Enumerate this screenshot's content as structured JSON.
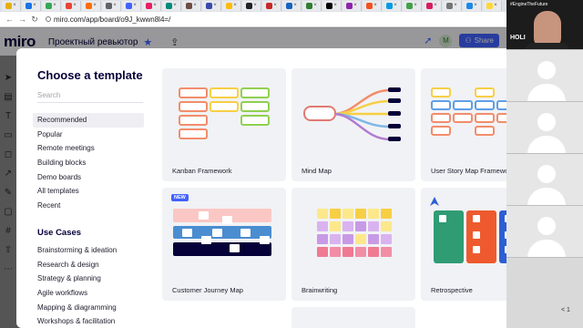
{
  "browser": {
    "url": "miro.com/app/board/o9J_kwwn8l4=/"
  },
  "app": {
    "logo": "miro",
    "board_name": "Проектный ревьютор",
    "share_label": "Share",
    "user_initial": "M"
  },
  "modal": {
    "title": "Choose a template",
    "search_placeholder": "Search",
    "categories": [
      {
        "label": "Recommended",
        "selected": true
      },
      {
        "label": "Popular"
      },
      {
        "label": "Remote meetings"
      },
      {
        "label": "Building blocks"
      },
      {
        "label": "Demo boards"
      },
      {
        "label": "All templates"
      },
      {
        "label": "Recent"
      }
    ],
    "use_cases_title": "Use Cases",
    "use_cases": [
      {
        "label": "Brainstorming & ideation"
      },
      {
        "label": "Research & design"
      },
      {
        "label": "Strategy & planning"
      },
      {
        "label": "Agile workflows"
      },
      {
        "label": "Mapping & diagramming"
      },
      {
        "label": "Workshops & facilitation"
      }
    ],
    "templates": [
      {
        "name": "Kanban Framework"
      },
      {
        "name": "Mind Map"
      },
      {
        "name": "User Story Map Framework"
      },
      {
        "name": "Customer Journey Map",
        "badge": "NEW"
      },
      {
        "name": "Brainwriting"
      },
      {
        "name": "Retrospective"
      }
    ]
  },
  "webcam": {
    "label": "#EngineTheFuture",
    "logo": "HOLI"
  },
  "edge_text": "< 1",
  "colors": {
    "accent": "#4262ff",
    "modal_bg": "#ffffff",
    "card_bg": "#f1f2f5",
    "selected_bg": "#eeeef3"
  }
}
